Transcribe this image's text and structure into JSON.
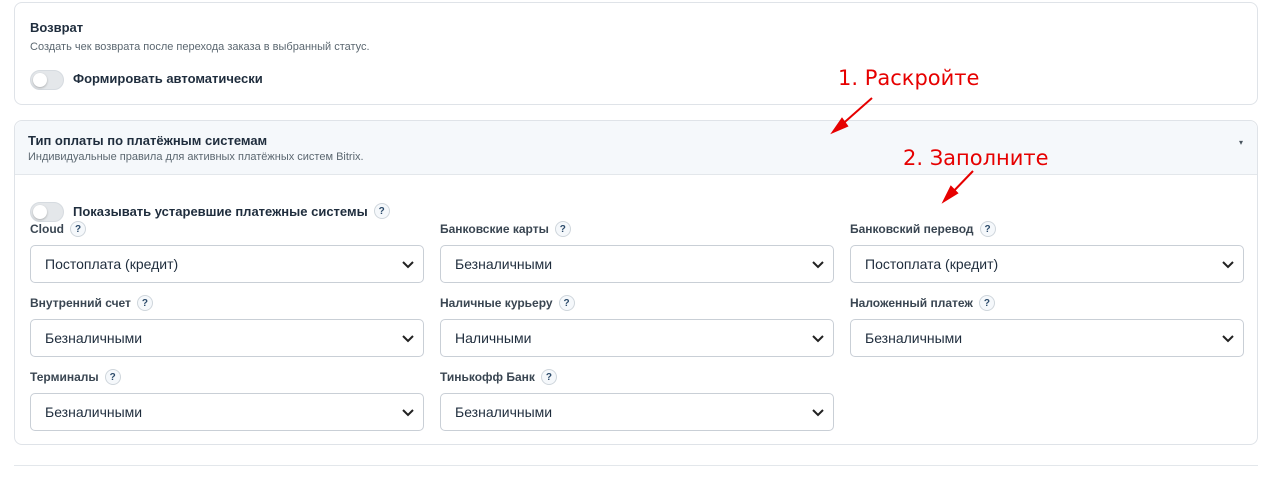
{
  "return_section": {
    "title": "Возврат",
    "description": "Создать чек возврата после перехода заказа в выбранный статус.",
    "auto_toggle_label": "Формировать автоматически"
  },
  "payment_section": {
    "title": "Тип оплаты по платёжным системам",
    "description": "Индивидуальные правила для активных платёжных систем Bitrix.",
    "show_deprecated_label": "Показывать устаревшие платежные системы",
    "help_glyph": "?",
    "caret_glyph": "▾",
    "fields": [
      {
        "label": "Cloud",
        "value": "Постоплата (кредит)"
      },
      {
        "label": "Банковские карты",
        "value": "Безналичными"
      },
      {
        "label": "Банковский перевод",
        "value": "Постоплата (кредит)"
      },
      {
        "label": "Внутренний счет",
        "value": "Безналичными"
      },
      {
        "label": "Наличные курьеру",
        "value": "Наличными"
      },
      {
        "label": "Наложенный платеж",
        "value": "Безналичными"
      },
      {
        "label": "Терминалы",
        "value": "Безналичными"
      },
      {
        "label": "Тинькофф Банк",
        "value": "Безналичными"
      }
    ]
  },
  "annotations": {
    "step1": "1. Раскройте",
    "step2": "2. Заполните",
    "color": "#e60000"
  }
}
